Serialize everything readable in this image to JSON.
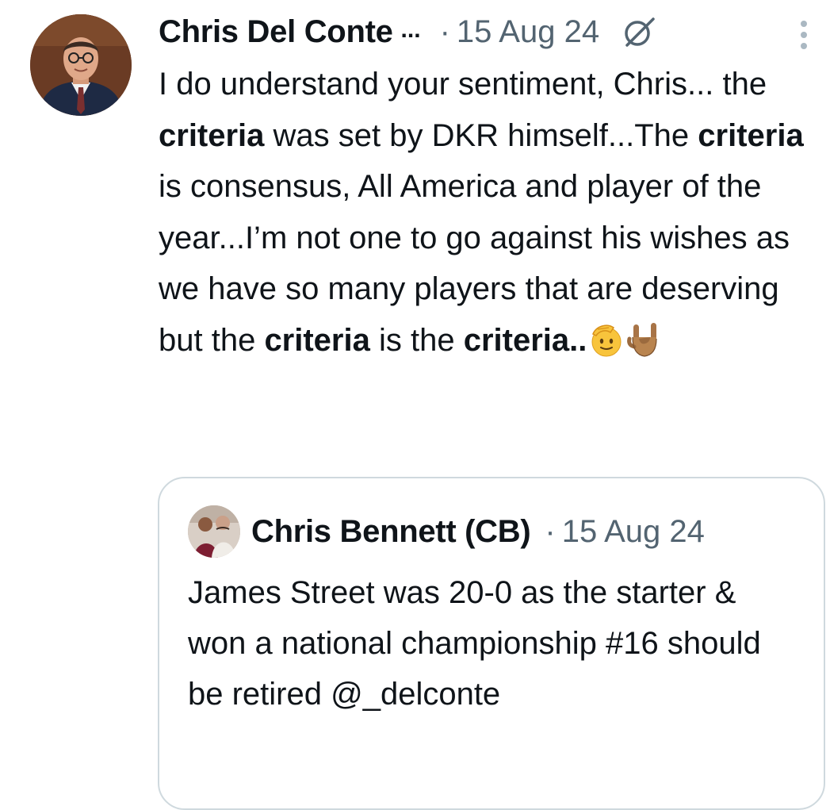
{
  "tweet": {
    "author_name": "Chris Del Conte",
    "name_truncation": "...",
    "separator": "·",
    "timestamp": "15 Aug 24",
    "grok_icon": "grok-slash-icon",
    "more_icon": "more-vertical-icon",
    "text_runs": [
      {
        "text": "I do understand your sentiment, Chris... the ",
        "bold": false
      },
      {
        "text": "criteria",
        "bold": true
      },
      {
        "text": " was set by DKR himself...The ",
        "bold": false
      },
      {
        "text": "criteria",
        "bold": true
      },
      {
        "text": " is consensus, All America and player of the year...I’m not one to go against his wishes as we have so many players that are deserving but the ",
        "bold": false
      },
      {
        "text": "criteria",
        "bold": true
      },
      {
        "text": " is the ",
        "bold": false
      },
      {
        "text": "criteria",
        "bold": true
      },
      {
        "text": "..",
        "bold": false
      }
    ],
    "emojis": [
      "saluting-face-emoji",
      "sign-of-the-horns-emoji"
    ]
  },
  "quoted_tweet": {
    "author_name": "Chris Bennett (CB)",
    "separator": "·",
    "timestamp": "15 Aug 24",
    "text": "James Street was 20-0 as the starter & won a national championship #16 should be retired @_delconte"
  },
  "colors": {
    "text_primary": "#0f1419",
    "text_secondary": "#536471",
    "border": "#cfd9de",
    "background": "#ffffff"
  }
}
